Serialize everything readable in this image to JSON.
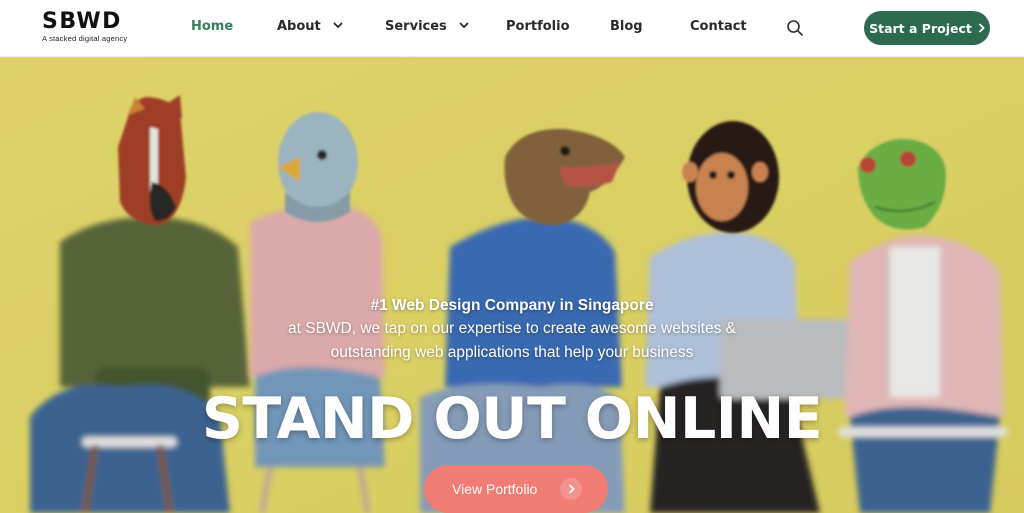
{
  "logo": {
    "mark": "SBWD",
    "tagline": "A stacked digital agency"
  },
  "nav": {
    "home": "Home",
    "about": "About",
    "services": "Services",
    "portfolio": "Portfolio",
    "blog": "Blog",
    "contact": "Contact"
  },
  "cta": {
    "label": "Start a Project"
  },
  "hero": {
    "kicker": "#1 Web Design Company in Singapore",
    "line2": "at SBWD, we tap on our expertise to create awesome websites &",
    "line3": "outstanding web applications that help your business",
    "headline": "STAND OUT ONLINE",
    "button": "View Portfolio"
  },
  "colors": {
    "brand_green": "#2c6b4f",
    "active_nav": "#3a7d61",
    "hero_bg": "#e7dc6b",
    "portfolio_button": "#f07c74"
  },
  "icons": [
    "chevron-down-icon",
    "search-icon",
    "chevron-right-icon"
  ]
}
